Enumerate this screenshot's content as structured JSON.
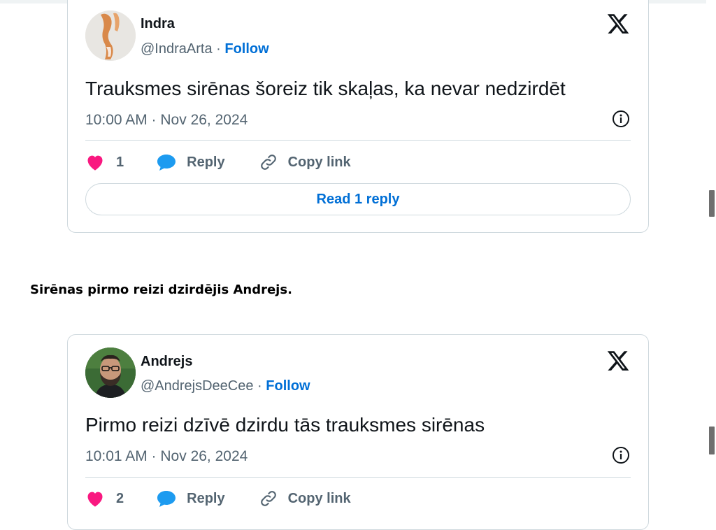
{
  "caption": "Sirēnas pirmo reizi dzirdējis Andrejs.",
  "tweets": [
    {
      "name": "Indra",
      "handle": "@IndraArta",
      "separator": " · ",
      "follow": "Follow",
      "text": "Trauksmes sirēnas šoreiz tik skaļas, ka nevar nedzirdēt",
      "timestamp": "10:00 AM · Nov 26, 2024",
      "likes": "1",
      "reply_label": "Reply",
      "copy_label": "Copy link",
      "read_replies": "Read 1 reply"
    },
    {
      "name": "Andrejs",
      "handle": "@AndrejsDeeCee",
      "separator": " · ",
      "follow": "Follow",
      "text": "Pirmo reizi dzīvē dzirdu tās trauksmes sirēnas",
      "timestamp": "10:01 AM · Nov 26, 2024",
      "likes": "2",
      "reply_label": "Reply",
      "copy_label": "Copy link"
    }
  ],
  "icons": {
    "platform": "x-logo-icon",
    "like": "heart-icon",
    "reply": "speech-bubble-icon",
    "copy": "link-icon",
    "info": "info-icon"
  },
  "colors": {
    "like": "#f91880",
    "reply": "#1d9bf0",
    "link": "#006fd6",
    "muted": "#536471",
    "border": "#cfd9de"
  }
}
